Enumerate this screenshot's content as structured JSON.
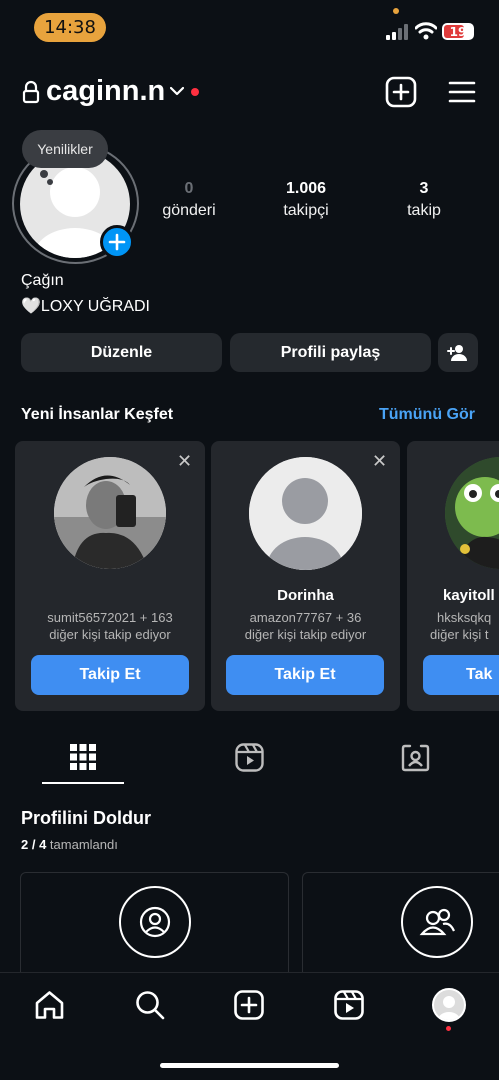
{
  "status_bar": {
    "time": "14:38",
    "battery": "19"
  },
  "header": {
    "username": "caginn.n"
  },
  "tooltip": {
    "text": "Yenilikler"
  },
  "stats": [
    {
      "value": "0",
      "label": "gönderi"
    },
    {
      "value": "1.006",
      "label": "takipçi"
    },
    {
      "value": "3",
      "label": "takip"
    }
  ],
  "bio": {
    "name": "Çağın",
    "line": "🤍LOXY UĞRADI"
  },
  "buttons": {
    "edit": "Düzenle",
    "share": "Profili paylaş"
  },
  "discover": {
    "title": "Yeni İnsanlar Keşfet",
    "see_all": "Tümünü Gör",
    "cards": [
      {
        "name": "",
        "line1": "sumit56572021 + 163",
        "line2": "diğer kişi takip ediyor",
        "button": "Takip Et"
      },
      {
        "name": "Dorinha",
        "line1": "amazon77767 + 36",
        "line2": "diğer kişi takip ediyor",
        "button": "Takip Et"
      },
      {
        "name": "kayitoll",
        "line1": "hksksqkq",
        "line2": "diğer kişi t",
        "button": "Tak"
      }
    ]
  },
  "complete_profile": {
    "title": "Profilini Doldur",
    "progress_count": "2 / 4",
    "progress_label": "tamamlandı"
  },
  "colors": {
    "accent": "#0095f6",
    "follow": "#3f8ef2",
    "link": "#4aa3f5",
    "notification": "#ff3040",
    "background": "#0c1015",
    "card": "#24272c"
  }
}
